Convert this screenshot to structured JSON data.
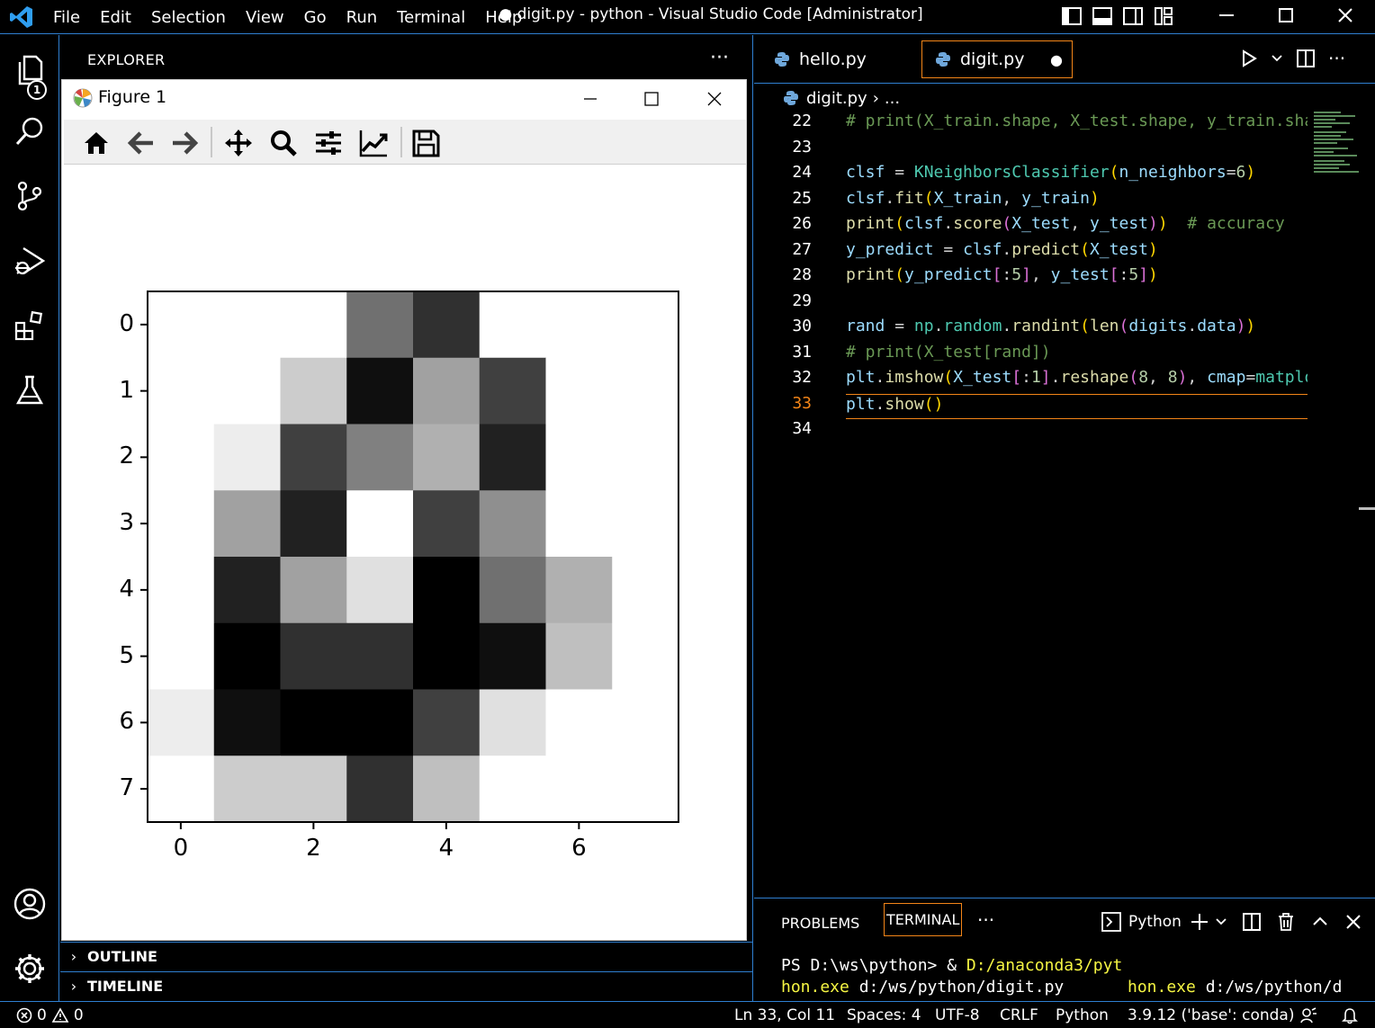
{
  "window": {
    "title": "● digit.py - python - Visual Studio Code [Administrator]",
    "menu": [
      "File",
      "Edit",
      "Selection",
      "View",
      "Go",
      "Run",
      "Terminal",
      "Help"
    ]
  },
  "activity": {
    "explorer_badge": "1"
  },
  "sidebar": {
    "title": "EXPLORER",
    "more": "···",
    "outline": "OUTLINE",
    "timeline": "TIMELINE"
  },
  "figure": {
    "title": "Figure 1"
  },
  "chart_data": {
    "type": "heatmap",
    "cmap": "gray",
    "rows": [
      "0",
      "1",
      "2",
      "3",
      "4",
      "5",
      "6",
      "7"
    ],
    "x_ticks": [
      "0",
      "2",
      "4",
      "6"
    ],
    "y_ticks": [
      "0",
      "1",
      "2",
      "3",
      "4",
      "5",
      "6",
      "7"
    ],
    "values": [
      [
        1.0,
        1.0,
        1.0,
        0.44,
        0.19,
        1.0,
        1.0,
        1.0
      ],
      [
        1.0,
        1.0,
        0.8,
        0.06,
        0.63,
        0.25,
        1.0,
        1.0
      ],
      [
        1.0,
        0.93,
        0.25,
        0.5,
        0.69,
        0.13,
        1.0,
        1.0
      ],
      [
        1.0,
        0.63,
        0.13,
        1.0,
        0.25,
        0.56,
        1.0,
        1.0
      ],
      [
        1.0,
        0.13,
        0.63,
        0.88,
        0.0,
        0.44,
        0.69,
        1.0
      ],
      [
        1.0,
        0.0,
        0.19,
        0.19,
        0.0,
        0.06,
        0.75,
        1.0
      ],
      [
        0.93,
        0.06,
        0.0,
        0.0,
        0.25,
        0.88,
        1.0,
        1.0
      ],
      [
        1.0,
        0.8,
        0.8,
        0.19,
        0.75,
        1.0,
        1.0,
        1.0
      ]
    ]
  },
  "editor": {
    "tabs": [
      {
        "label": "hello.py",
        "active": false
      },
      {
        "label": "digit.py",
        "active": true,
        "dirty": "●"
      }
    ],
    "breadcrumb": {
      "file": "digit.py",
      "rest": "..."
    },
    "current_line": "33",
    "lines": [
      {
        "n": "22",
        "tokens": [
          [
            "# print(X_train.shape, X_test.shape, y_train.shape, y_test.shape)",
            "#6a9955"
          ]
        ]
      },
      {
        "n": "23",
        "tokens": []
      },
      {
        "n": "24",
        "tokens": [
          [
            "clsf",
            "#9cdcfe"
          ],
          [
            " = ",
            "#d4d4d4"
          ],
          [
            "KNeighborsClassifier",
            "#4ec9b0"
          ],
          [
            "(",
            "#ffd700"
          ],
          [
            "n_neighbors",
            "#9cdcfe"
          ],
          [
            "=",
            "#d4d4d4"
          ],
          [
            "6",
            "#b5cea8"
          ],
          [
            ")",
            "#ffd700"
          ]
        ]
      },
      {
        "n": "25",
        "tokens": [
          [
            "clsf",
            "#9cdcfe"
          ],
          [
            ".",
            "#d4d4d4"
          ],
          [
            "fit",
            "#dcdcaa"
          ],
          [
            "(",
            "#ffd700"
          ],
          [
            "X_train",
            "#9cdcfe"
          ],
          [
            ", ",
            "#d4d4d4"
          ],
          [
            "y_train",
            "#9cdcfe"
          ],
          [
            ")",
            "#ffd700"
          ]
        ]
      },
      {
        "n": "26",
        "tokens": [
          [
            "print",
            "#dcdcaa"
          ],
          [
            "(",
            "#ffd700"
          ],
          [
            "clsf",
            "#9cdcfe"
          ],
          [
            ".",
            "#d4d4d4"
          ],
          [
            "score",
            "#dcdcaa"
          ],
          [
            "(",
            "#da70d6"
          ],
          [
            "X_test",
            "#9cdcfe"
          ],
          [
            ", ",
            "#d4d4d4"
          ],
          [
            "y_test",
            "#9cdcfe"
          ],
          [
            ")",
            "#da70d6"
          ],
          [
            ")",
            "#ffd700"
          ],
          [
            "  ",
            "#d4d4d4"
          ],
          [
            "# accuracy",
            "#6a9955"
          ]
        ]
      },
      {
        "n": "27",
        "tokens": [
          [
            "y_predict",
            "#9cdcfe"
          ],
          [
            " = ",
            "#d4d4d4"
          ],
          [
            "clsf",
            "#9cdcfe"
          ],
          [
            ".",
            "#d4d4d4"
          ],
          [
            "predict",
            "#dcdcaa"
          ],
          [
            "(",
            "#ffd700"
          ],
          [
            "X_test",
            "#9cdcfe"
          ],
          [
            ")",
            "#ffd700"
          ]
        ]
      },
      {
        "n": "28",
        "tokens": [
          [
            "print",
            "#dcdcaa"
          ],
          [
            "(",
            "#ffd700"
          ],
          [
            "y_predict",
            "#9cdcfe"
          ],
          [
            "[",
            "#da70d6"
          ],
          [
            ":",
            "#d4d4d4"
          ],
          [
            "5",
            "#b5cea8"
          ],
          [
            "]",
            "#da70d6"
          ],
          [
            ", ",
            "#d4d4d4"
          ],
          [
            "y_test",
            "#9cdcfe"
          ],
          [
            "[",
            "#da70d6"
          ],
          [
            ":",
            "#d4d4d4"
          ],
          [
            "5",
            "#b5cea8"
          ],
          [
            "]",
            "#da70d6"
          ],
          [
            ")",
            "#ffd700"
          ]
        ]
      },
      {
        "n": "29",
        "tokens": []
      },
      {
        "n": "30",
        "tokens": [
          [
            "rand",
            "#9cdcfe"
          ],
          [
            " = ",
            "#d4d4d4"
          ],
          [
            "np",
            "#4ec9b0"
          ],
          [
            ".",
            "#d4d4d4"
          ],
          [
            "random",
            "#4ec9b0"
          ],
          [
            ".",
            "#d4d4d4"
          ],
          [
            "randint",
            "#dcdcaa"
          ],
          [
            "(",
            "#ffd700"
          ],
          [
            "len",
            "#dcdcaa"
          ],
          [
            "(",
            "#da70d6"
          ],
          [
            "digits",
            "#9cdcfe"
          ],
          [
            ".",
            "#d4d4d4"
          ],
          [
            "data",
            "#9cdcfe"
          ],
          [
            ")",
            "#da70d6"
          ],
          [
            ")",
            "#ffd700"
          ]
        ]
      },
      {
        "n": "31",
        "tokens": [
          [
            "# print(X_test[rand])",
            "#6a9955"
          ]
        ]
      },
      {
        "n": "32",
        "tokens": [
          [
            "plt",
            "#9cdcfe"
          ],
          [
            ".",
            "#d4d4d4"
          ],
          [
            "imshow",
            "#dcdcaa"
          ],
          [
            "(",
            "#ffd700"
          ],
          [
            "X_test",
            "#9cdcfe"
          ],
          [
            "[",
            "#da70d6"
          ],
          [
            ":",
            "#d4d4d4"
          ],
          [
            "1",
            "#b5cea8"
          ],
          [
            "]",
            "#da70d6"
          ],
          [
            ".",
            "#d4d4d4"
          ],
          [
            "reshape",
            "#dcdcaa"
          ],
          [
            "(",
            "#da70d6"
          ],
          [
            "8",
            "#b5cea8"
          ],
          [
            ", ",
            "#d4d4d4"
          ],
          [
            "8",
            "#b5cea8"
          ],
          [
            ")",
            "#da70d6"
          ],
          [
            ", ",
            "#d4d4d4"
          ],
          [
            "cmap",
            "#9cdcfe"
          ],
          [
            "=",
            "#d4d4d4"
          ],
          [
            "matplotlib",
            "#4ec9b0"
          ]
        ]
      },
      {
        "n": "33",
        "tokens": [
          [
            "plt",
            "#9cdcfe"
          ],
          [
            ".",
            "#d4d4d4"
          ],
          [
            "show",
            "#dcdcaa"
          ],
          [
            "(",
            "#ffd700"
          ],
          [
            ")",
            "#ffd700"
          ]
        ]
      },
      {
        "n": "34",
        "tokens": []
      }
    ]
  },
  "panel": {
    "tabs": [
      "PROBLEMS",
      "TERMINAL"
    ],
    "more": "···",
    "terminal_name": "Python",
    "terminal": {
      "line1_prompt": "PS D:\\ws\\python> & ",
      "line1_path": "D:/anaconda3/pyt",
      "line2_a_hl": "hon.exe",
      "line2_a": " d:/ws/python/digit.py",
      "line2_b_hl": "hon.exe",
      "line2_b": " d:/ws/python/d"
    }
  },
  "status": {
    "errors": "0",
    "warnings": "0",
    "position": "Ln 33, Col 11",
    "spaces": "Spaces: 4",
    "encoding": "UTF-8",
    "eol": "CRLF",
    "language": "Python",
    "interpreter": "3.9.12 ('base': conda)"
  },
  "colors": {
    "accent_border": "#2f7fd1",
    "active_highlight": "#f38518",
    "terminal_yellow": "#f5f543"
  }
}
